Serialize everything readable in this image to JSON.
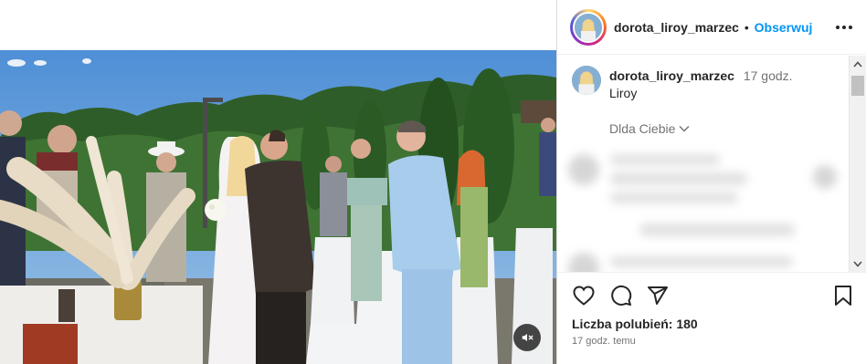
{
  "post": {
    "username": "dorota_liroy_marzec",
    "separator": "•",
    "follow_label": "Obserwuj",
    "more_icon": "more-horizontal-icon",
    "caption": {
      "username": "dorota_liroy_marzec",
      "time": "17 godz.",
      "text": "Liroy"
    },
    "comment_filter": "Dlda Ciebie",
    "likes_label": "Liczba polubień: 180",
    "posted_ago": "17 godz. temu"
  },
  "media": {
    "type": "video",
    "sound": "muted",
    "mute_icon": "speaker-muted-icon"
  },
  "icons": {
    "like": "heart-icon",
    "comment": "comment-icon",
    "share": "send-icon",
    "save": "bookmark-icon"
  },
  "colors": {
    "follow": "#0095f6",
    "text": "#262626",
    "secondary": "#737373"
  }
}
